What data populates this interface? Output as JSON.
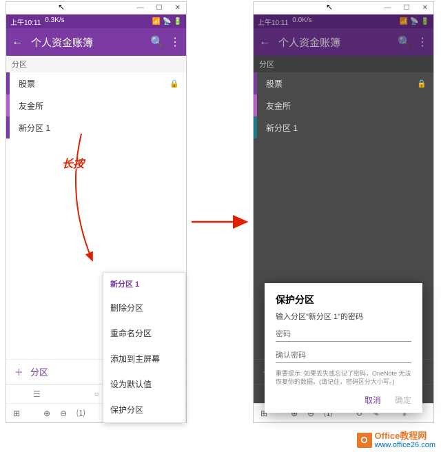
{
  "left": {
    "win": {
      "min": "—",
      "max": "☐",
      "close": "✕"
    },
    "status": {
      "time": "上午10:11",
      "speed": "0.3K/s"
    },
    "appbar": {
      "back": "←",
      "title": "个人资金账簿",
      "search": "🔍",
      "more": "⋮"
    },
    "sectionHeader": "分区",
    "items": [
      {
        "label": "股票",
        "stripe": "#7b3ba3",
        "locked": true
      },
      {
        "label": "友金所",
        "stripe": "#b25fc8",
        "locked": false
      },
      {
        "label": "新分区 1",
        "stripe": "#7b3ba3",
        "locked": false
      }
    ],
    "longPressLabel": "长按",
    "menu": {
      "title": "新分区 1",
      "items": [
        "删除分区",
        "重命名分区",
        "添加到主屏幕",
        "设为默认值",
        "保护分区"
      ]
    },
    "addSection": {
      "plus": "＋",
      "label": "分区"
    },
    "nav": {
      "back": "◁",
      "home": "○",
      "recent": "☰"
    },
    "toolbar": [
      "⊞",
      "⊕",
      "⊖",
      "⑴",
      "↻",
      "✎",
      "⤓"
    ]
  },
  "right": {
    "win": {
      "min": "—",
      "max": "☐",
      "close": "✕"
    },
    "status": {
      "time": "上午10:11",
      "speed": "0.0K/s"
    },
    "appbar": {
      "back": "←",
      "title": "个人资金账簿",
      "search": "🔍",
      "more": "⋮"
    },
    "sectionHeader": "分区",
    "items": [
      {
        "label": "股票",
        "stripe": "#7b3ba3",
        "locked": true
      },
      {
        "label": "友金所",
        "stripe": "#b25fc8",
        "locked": false
      },
      {
        "label": "新分区 1",
        "stripe": "#1b7a8c",
        "locked": false
      }
    ],
    "dialog": {
      "title": "保护分区",
      "subtitle": "输入分区\"新分区 1\"的密码",
      "pw1": "密码",
      "pw2": "确认密码",
      "hint": "重要提示: 如果丢失或忘记了密码，OneNote 无法恢复你的数据。(请记住，密码区分大小写。)",
      "cancel": "取消",
      "ok": "确定"
    },
    "addSection": {
      "plus": "＋",
      "label": "分区"
    },
    "nav": {
      "back": "◁",
      "home": "○",
      "recent": "☰"
    },
    "toolbar": [
      "⊞",
      "⊕",
      "⊖",
      "⑴",
      "↻",
      "✎",
      "⤓"
    ]
  },
  "watermark": {
    "icon": "O",
    "title": "Office教程网",
    "url": "www.office26.com"
  }
}
